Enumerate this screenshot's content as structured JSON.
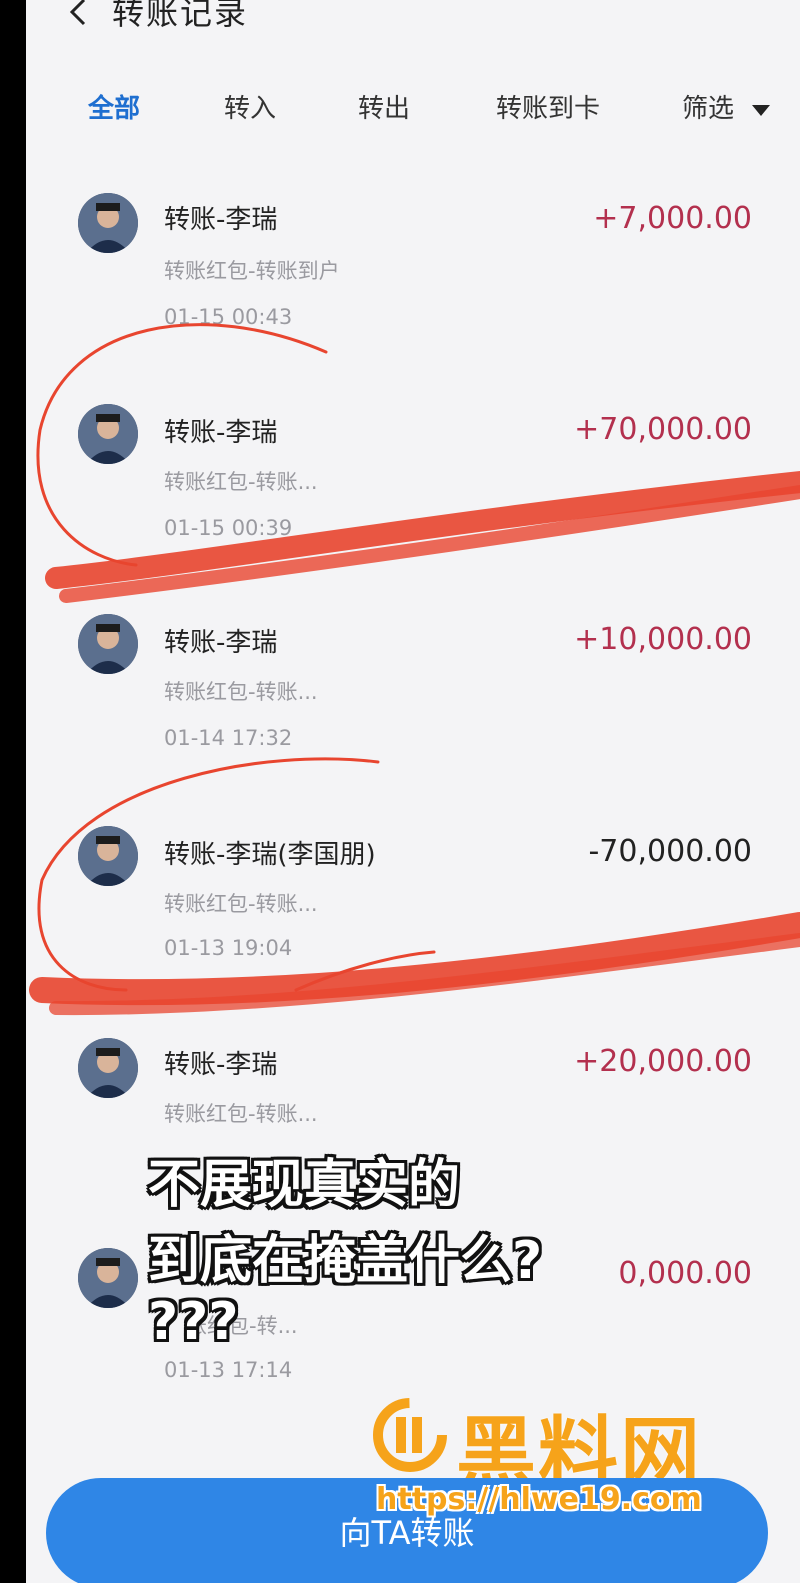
{
  "header": {
    "title": "转账记录"
  },
  "tabs": [
    {
      "label": "全部",
      "active": true
    },
    {
      "label": "转入",
      "active": false
    },
    {
      "label": "转出",
      "active": false
    },
    {
      "label": "转账到卡",
      "active": false
    },
    {
      "label": "筛选",
      "active": false
    }
  ],
  "records": [
    {
      "name": "转账-李瑞",
      "subtitle": "转账红包-转账到户",
      "time": "01-15 00:43",
      "amount": "+7,000.00"
    },
    {
      "name": "转账-李瑞",
      "subtitle": "转账红包-转账...",
      "time": "01-15 00:39",
      "amount": "+70,000.00"
    },
    {
      "name": "转账-李瑞",
      "subtitle": "转账红包-转账...",
      "time": "01-14 17:32",
      "amount": "+10,000.00"
    },
    {
      "name": "转账-李瑞(李国朋)",
      "subtitle": "转账红包-转账...",
      "time": "01-13 19:04",
      "amount": "-70,000.00"
    },
    {
      "name": "转账-李瑞",
      "subtitle": "转账红包-转账...",
      "time": "",
      "amount": "+20,000.00"
    },
    {
      "name": "",
      "subtitle": "账红包-转...",
      "time": "01-13 17:14",
      "amount": "0,000.00"
    }
  ],
  "overlay": {
    "line1": "不展现真实的",
    "line2": "到底在掩盖什么?",
    "line3": "???"
  },
  "watermark": {
    "brand": "黑料网",
    "url": "https://hlwe19.com"
  },
  "footer": {
    "button_label": "向TA转账"
  },
  "colors": {
    "accent": "#1f6fd0",
    "income": "#b3304e",
    "button": "#2f86e6",
    "annotation": "#e8452f",
    "watermark": "#f6a31a"
  }
}
